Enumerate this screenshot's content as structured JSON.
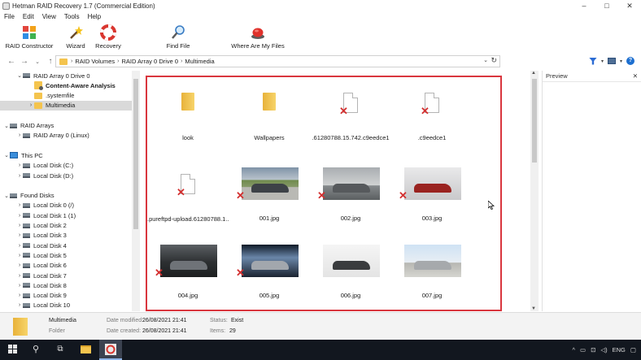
{
  "window": {
    "title": "Hetman RAID Recovery 1.7 (Commercial Edition)",
    "min": "–",
    "max": "□",
    "close": "✕"
  },
  "menu": [
    "File",
    "Edit",
    "View",
    "Tools",
    "Help"
  ],
  "toolbar": [
    {
      "label": "RAID Constructor",
      "icon": "puzzle-icon"
    },
    {
      "label": "Wizard",
      "icon": "wand-icon"
    },
    {
      "label": "Recovery",
      "icon": "lifebuoy-icon"
    },
    {
      "label": "Find File",
      "icon": "magnifier-icon"
    },
    {
      "label": "Where Are My Files",
      "icon": "red-button-icon"
    }
  ],
  "address": {
    "crumbs": [
      "RAID Volumes",
      "RAID Array 0 Drive 0",
      "Multimedia"
    ]
  },
  "tree": [
    {
      "label": "RAID Array 0 Drive 0",
      "level": 1,
      "chev": "⌄",
      "icon": "drive",
      "bold": false
    },
    {
      "label": "Content-Aware Analysis",
      "level": 2,
      "chev": "",
      "icon": "special",
      "bold": true
    },
    {
      "label": ".systemfile",
      "level": 2,
      "chev": "",
      "icon": "folder",
      "bold": false
    },
    {
      "label": "Multimedia",
      "level": 2,
      "chev": "›",
      "icon": "folder",
      "bold": false,
      "selected": true
    },
    {
      "label": "",
      "level": 0,
      "chev": "",
      "icon": "",
      "bold": false
    },
    {
      "label": "RAID Arrays",
      "level": 0,
      "chev": "⌄",
      "icon": "drive",
      "bold": false
    },
    {
      "label": "RAID Array 0 (Linux)",
      "level": 1,
      "chev": "›",
      "icon": "drive",
      "bold": false
    },
    {
      "label": "",
      "level": 0,
      "chev": "",
      "icon": "",
      "bold": false
    },
    {
      "label": "This PC",
      "level": 0,
      "chev": "⌄",
      "icon": "pc",
      "bold": false
    },
    {
      "label": "Local Disk (C:)",
      "level": 1,
      "chev": "›",
      "icon": "drive",
      "bold": false
    },
    {
      "label": "Local Disk (D:)",
      "level": 1,
      "chev": "›",
      "icon": "drive",
      "bold": false
    },
    {
      "label": "",
      "level": 0,
      "chev": "",
      "icon": "",
      "bold": false
    },
    {
      "label": "Found Disks",
      "level": 0,
      "chev": "⌄",
      "icon": "drive",
      "bold": false
    },
    {
      "label": "Local Disk 0 (/)",
      "level": 1,
      "chev": "›",
      "icon": "drive",
      "bold": false
    },
    {
      "label": "Local Disk 1 (1)",
      "level": 1,
      "chev": "›",
      "icon": "drive",
      "bold": false
    },
    {
      "label": "Local Disk 2",
      "level": 1,
      "chev": "›",
      "icon": "drive",
      "bold": false
    },
    {
      "label": "Local Disk 3",
      "level": 1,
      "chev": "›",
      "icon": "drive",
      "bold": false
    },
    {
      "label": "Local Disk 4",
      "level": 1,
      "chev": "›",
      "icon": "drive",
      "bold": false
    },
    {
      "label": "Local Disk 5",
      "level": 1,
      "chev": "›",
      "icon": "drive",
      "bold": false
    },
    {
      "label": "Local Disk 6",
      "level": 1,
      "chev": "›",
      "icon": "drive",
      "bold": false
    },
    {
      "label": "Local Disk 7",
      "level": 1,
      "chev": "›",
      "icon": "drive",
      "bold": false
    },
    {
      "label": "Local Disk 8",
      "level": 1,
      "chev": "›",
      "icon": "drive",
      "bold": false
    },
    {
      "label": "Local Disk 9",
      "level": 1,
      "chev": "›",
      "icon": "drive",
      "bold": false
    },
    {
      "label": "Local Disk 10",
      "level": 1,
      "chev": "›",
      "icon": "drive",
      "bold": false
    }
  ],
  "files": [
    {
      "name": "look",
      "kind": "folder",
      "deleted": false
    },
    {
      "name": "Wallpapers",
      "kind": "folder",
      "deleted": false
    },
    {
      "name": ".61280788.15.742.c9eedce1",
      "kind": "doc",
      "deleted": true
    },
    {
      "name": ".c9eedce1",
      "kind": "doc",
      "deleted": true
    },
    {
      "name": ".pureftpd-upload.61280788.1...",
      "kind": "doc",
      "deleted": true
    },
    {
      "name": "001.jpg",
      "kind": "photo",
      "deleted": true,
      "scene": "car-park"
    },
    {
      "name": "002.jpg",
      "kind": "photo",
      "deleted": true,
      "scene": "car-grey"
    },
    {
      "name": "003.jpg",
      "kind": "photo",
      "deleted": true,
      "scene": "car-concept"
    },
    {
      "name": "004.jpg",
      "kind": "photo",
      "deleted": true,
      "scene": "car-dark"
    },
    {
      "name": "005.jpg",
      "kind": "photo",
      "deleted": true,
      "scene": "car-tunnel"
    },
    {
      "name": "006.jpg",
      "kind": "photo",
      "deleted": false,
      "scene": "car-white"
    },
    {
      "name": "007.jpg",
      "kind": "photo",
      "deleted": false,
      "scene": "car-wagon"
    }
  ],
  "preview": {
    "title": "Preview",
    "close": "✕"
  },
  "status": {
    "name": "Multimedia",
    "type": "Folder",
    "modified_label": "Date modified:",
    "modified": "26/08/2021 21:41",
    "created_label": "Date created:",
    "created": "26/08/2021 21:41",
    "status_label": "Status:",
    "status": "Exist",
    "items_label": "Items:",
    "items": "29"
  },
  "taskbar": {
    "lang": "ENG"
  }
}
